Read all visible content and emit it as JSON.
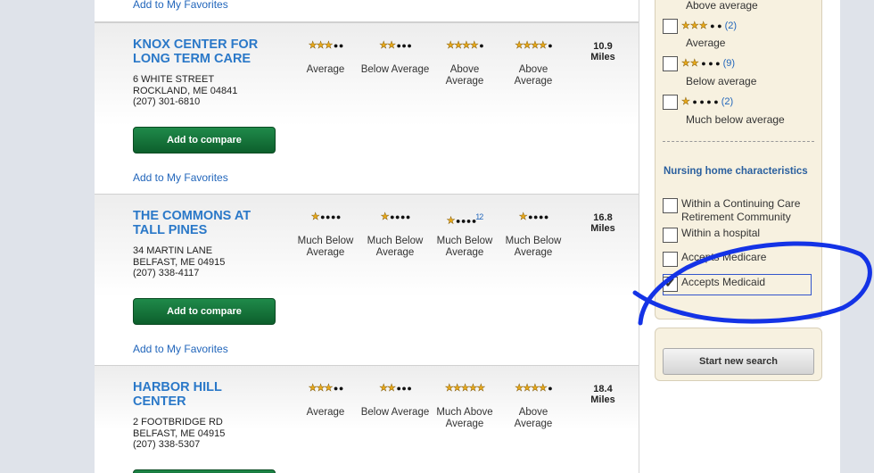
{
  "results": [
    {
      "name": "",
      "favorites_label": "Add to My Favorites"
    },
    {
      "name_line1": "KNOX CENTER FOR",
      "name_line2": "LONG TERM CARE",
      "street": "6 WHITE STREET",
      "city": "ROCKLAND, ME 04841",
      "phone": "(207) 301-6810",
      "compare_label": "Add to compare",
      "favorites_label": "Add to My Favorites",
      "distance": "10.9",
      "distance_unit": "Miles",
      "ratings": [
        {
          "stars": 3,
          "label": "Average",
          "note": ""
        },
        {
          "stars": 2,
          "label": "Below Average",
          "note": ""
        },
        {
          "stars": 4,
          "label": "Above Average",
          "note": ""
        },
        {
          "stars": 4,
          "label": "Above Average",
          "note": ""
        }
      ]
    },
    {
      "name_line1": "THE COMMONS AT",
      "name_line2": "TALL PINES",
      "street": "34 MARTIN LANE",
      "city": "BELFAST, ME 04915",
      "phone": "(207) 338-4117",
      "compare_label": "Add to compare",
      "favorites_label": "Add to My Favorites",
      "distance": "16.8",
      "distance_unit": "Miles",
      "ratings": [
        {
          "stars": 1,
          "label": "Much Below Average",
          "note": ""
        },
        {
          "stars": 1,
          "label": "Much Below Average",
          "note": ""
        },
        {
          "stars": 1,
          "label": "Much Below Average",
          "note": "12"
        },
        {
          "stars": 1,
          "label": "Much Below Average",
          "note": ""
        }
      ]
    },
    {
      "name_line1": "HARBOR HILL",
      "name_line2": "CENTER",
      "street": "2 FOOTBRIDGE RD",
      "city": "BELFAST, ME 04915",
      "phone": "(207) 338-5307",
      "distance": "18.4",
      "distance_unit": "Miles",
      "ratings": [
        {
          "stars": 3,
          "label": "Average",
          "note": ""
        },
        {
          "stars": 2,
          "label": "Below Average",
          "note": ""
        },
        {
          "stars": 5,
          "label": "Much Above Average",
          "note": ""
        },
        {
          "stars": 4,
          "label": "Above Average",
          "note": ""
        }
      ]
    }
  ],
  "sidebar": {
    "above_average_label": "Above average",
    "star_filters": [
      {
        "stars": 3,
        "count": "(2)",
        "label": "Average"
      },
      {
        "stars": 2,
        "count": "(9)",
        "label": "Below average"
      },
      {
        "stars": 1,
        "count": "(2)",
        "label": "Much below average"
      }
    ],
    "characteristics_title": "Nursing home characteristics",
    "characteristics": [
      {
        "label_line1": "Within a Continuing Care",
        "label_line2": "Retirement Community",
        "checked": false
      },
      {
        "label_line1": "Within a hospital",
        "label_line2": "",
        "checked": false
      },
      {
        "label_line1": "Accepts Medicare",
        "label_line2": "",
        "checked": false
      },
      {
        "label_line1": "Accepts Medicaid",
        "label_line2": "",
        "checked": true
      }
    ],
    "new_search_label": "Start new search"
  },
  "colors": {
    "link": "#2266bb",
    "name": "#2a78c8",
    "button_green": "#1f8a4a",
    "star": "#e7a81a",
    "annotation": "#1433e6"
  },
  "icons": [
    "star-icon",
    "dot-icon",
    "checkbox-icon",
    "checkmark-icon"
  ]
}
